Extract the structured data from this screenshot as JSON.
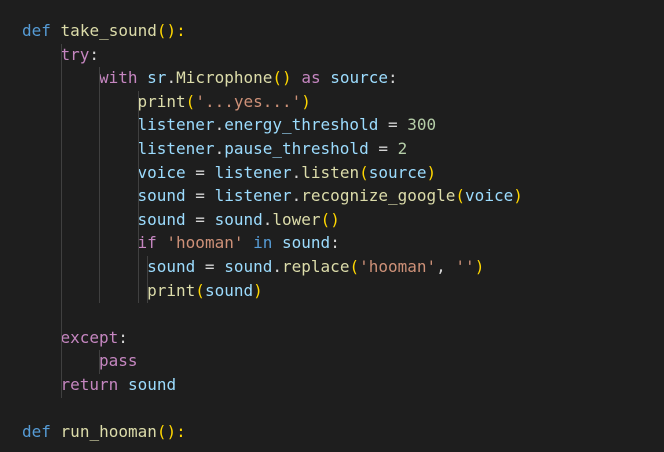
{
  "editor": {
    "background": "#1e1e1e",
    "colors": {
      "keyword": "#569cd6",
      "control": "#c586c0",
      "function": "#dcdcaa",
      "variable": "#9cdcfe",
      "string": "#ce9178",
      "number": "#b5cea8",
      "bracket_level1": "#ffd700",
      "bracket_level2": "#da70d6",
      "indent_guide": "#404040"
    },
    "lines": [
      {
        "indent": 0,
        "tokens": [
          {
            "t": "def",
            "c": "kw"
          },
          {
            "t": " ",
            "c": "plain"
          },
          {
            "t": "take_sound",
            "c": "fn"
          },
          {
            "t": "():",
            "c": "p1"
          }
        ]
      },
      {
        "indent": 1,
        "tokens": [
          {
            "t": "try",
            "c": "ctrl"
          },
          {
            "t": ":",
            "c": "plain"
          }
        ]
      },
      {
        "indent": 2,
        "tokens": [
          {
            "t": "with",
            "c": "ctrl"
          },
          {
            "t": " ",
            "c": "plain"
          },
          {
            "t": "sr",
            "c": "var"
          },
          {
            "t": ".",
            "c": "plain"
          },
          {
            "t": "Microphone",
            "c": "fn"
          },
          {
            "t": "()",
            "c": "p1"
          },
          {
            "t": " ",
            "c": "plain"
          },
          {
            "t": "as",
            "c": "ctrl"
          },
          {
            "t": " ",
            "c": "plain"
          },
          {
            "t": "source",
            "c": "var"
          },
          {
            "t": ":",
            "c": "plain"
          }
        ]
      },
      {
        "indent": 3,
        "tokens": [
          {
            "t": "print",
            "c": "fn"
          },
          {
            "t": "(",
            "c": "p1"
          },
          {
            "t": "'...yes...'",
            "c": "str"
          },
          {
            "t": ")",
            "c": "p1"
          }
        ]
      },
      {
        "indent": 3,
        "tokens": [
          {
            "t": "listener",
            "c": "var"
          },
          {
            "t": ".",
            "c": "plain"
          },
          {
            "t": "energy_threshold",
            "c": "var"
          },
          {
            "t": " = ",
            "c": "plain"
          },
          {
            "t": "300",
            "c": "num"
          }
        ]
      },
      {
        "indent": 3,
        "tokens": [
          {
            "t": "listener",
            "c": "var"
          },
          {
            "t": ".",
            "c": "plain"
          },
          {
            "t": "pause_threshold",
            "c": "var"
          },
          {
            "t": " = ",
            "c": "plain"
          },
          {
            "t": "2",
            "c": "num"
          }
        ]
      },
      {
        "indent": 3,
        "tokens": [
          {
            "t": "voice",
            "c": "var"
          },
          {
            "t": " = ",
            "c": "plain"
          },
          {
            "t": "listener",
            "c": "var"
          },
          {
            "t": ".",
            "c": "plain"
          },
          {
            "t": "listen",
            "c": "fn"
          },
          {
            "t": "(",
            "c": "p1"
          },
          {
            "t": "source",
            "c": "var"
          },
          {
            "t": ")",
            "c": "p1"
          }
        ]
      },
      {
        "indent": 3,
        "tokens": [
          {
            "t": "sound",
            "c": "var"
          },
          {
            "t": " = ",
            "c": "plain"
          },
          {
            "t": "listener",
            "c": "var"
          },
          {
            "t": ".",
            "c": "plain"
          },
          {
            "t": "recognize_google",
            "c": "fn"
          },
          {
            "t": "(",
            "c": "p1"
          },
          {
            "t": "voice",
            "c": "var"
          },
          {
            "t": ")",
            "c": "p1"
          }
        ]
      },
      {
        "indent": 3,
        "tokens": [
          {
            "t": "sound",
            "c": "var"
          },
          {
            "t": " = ",
            "c": "plain"
          },
          {
            "t": "sound",
            "c": "var"
          },
          {
            "t": ".",
            "c": "plain"
          },
          {
            "t": "lower",
            "c": "fn"
          },
          {
            "t": "()",
            "c": "p1"
          }
        ]
      },
      {
        "indent": 3,
        "tokens": [
          {
            "t": "if",
            "c": "ctrl"
          },
          {
            "t": " ",
            "c": "plain"
          },
          {
            "t": "'hooman'",
            "c": "str"
          },
          {
            "t": " ",
            "c": "plain"
          },
          {
            "t": "in",
            "c": "kw"
          },
          {
            "t": " ",
            "c": "plain"
          },
          {
            "t": "sound",
            "c": "var"
          },
          {
            "t": ":",
            "c": "plain"
          }
        ]
      },
      {
        "indent": 3.25,
        "tokens": [
          {
            "t": "sound",
            "c": "var"
          },
          {
            "t": " = ",
            "c": "plain"
          },
          {
            "t": "sound",
            "c": "var"
          },
          {
            "t": ".",
            "c": "plain"
          },
          {
            "t": "replace",
            "c": "fn"
          },
          {
            "t": "(",
            "c": "p1"
          },
          {
            "t": "'hooman'",
            "c": "str"
          },
          {
            "t": ", ",
            "c": "plain"
          },
          {
            "t": "''",
            "c": "str"
          },
          {
            "t": ")",
            "c": "p1"
          }
        ]
      },
      {
        "indent": 3.25,
        "tokens": [
          {
            "t": "print",
            "c": "fn"
          },
          {
            "t": "(",
            "c": "p1"
          },
          {
            "t": "sound",
            "c": "var"
          },
          {
            "t": ")",
            "c": "p1"
          }
        ]
      },
      {
        "indent": 0,
        "tokens": []
      },
      {
        "indent": 1,
        "tokens": [
          {
            "t": "except",
            "c": "ctrl"
          },
          {
            "t": ":",
            "c": "plain"
          }
        ]
      },
      {
        "indent": 2,
        "tokens": [
          {
            "t": "pass",
            "c": "ctrl"
          }
        ]
      },
      {
        "indent": 1,
        "tokens": [
          {
            "t": "return",
            "c": "ctrl"
          },
          {
            "t": " ",
            "c": "plain"
          },
          {
            "t": "sound",
            "c": "var"
          }
        ]
      },
      {
        "indent": 0,
        "tokens": []
      },
      {
        "indent": 0,
        "tokens": [
          {
            "t": "def",
            "c": "kw"
          },
          {
            "t": " ",
            "c": "plain"
          },
          {
            "t": "run_hooman",
            "c": "fn"
          },
          {
            "t": "():",
            "c": "p1"
          }
        ]
      }
    ]
  }
}
